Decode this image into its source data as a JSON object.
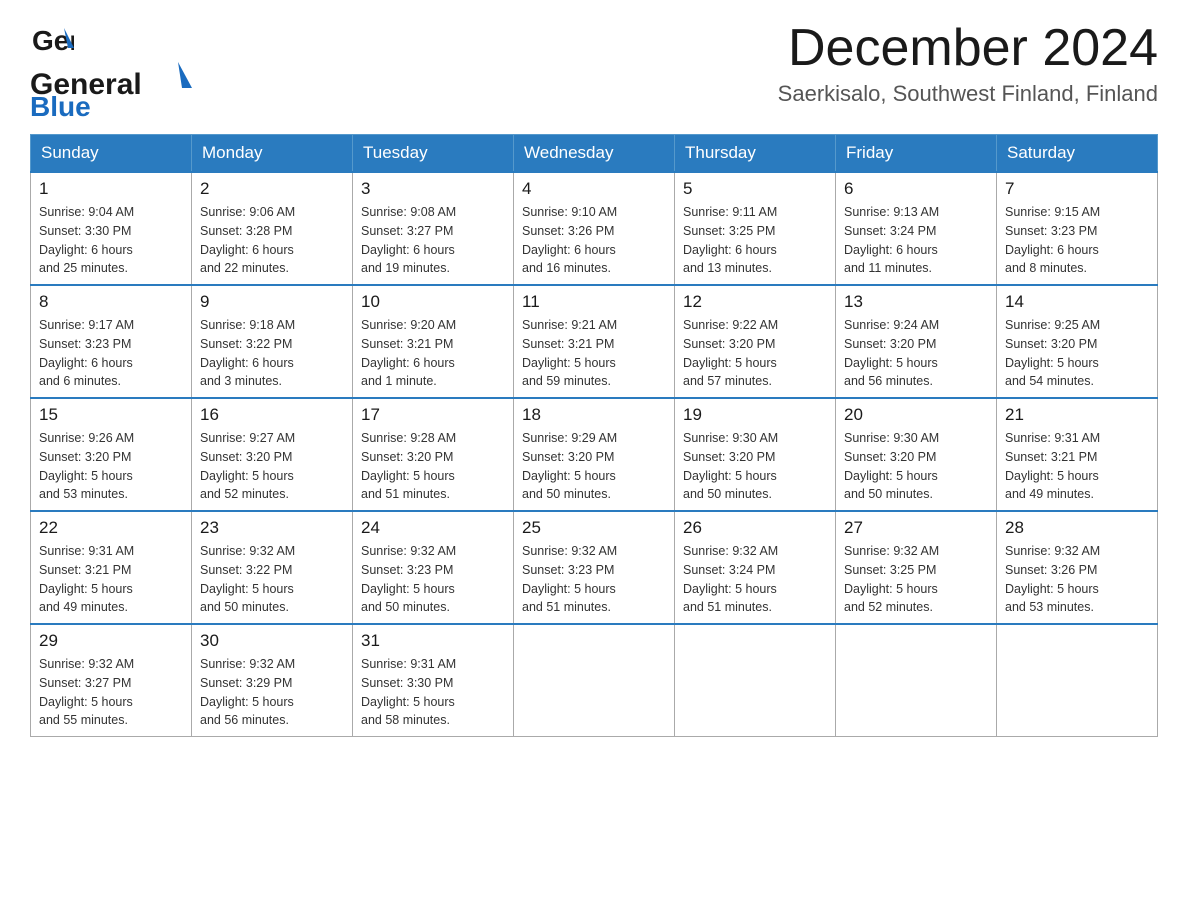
{
  "header": {
    "logo_general": "General",
    "logo_blue": "Blue",
    "month_title": "December 2024",
    "location": "Saerkisalo, Southwest Finland, Finland"
  },
  "weekdays": [
    "Sunday",
    "Monday",
    "Tuesday",
    "Wednesday",
    "Thursday",
    "Friday",
    "Saturday"
  ],
  "weeks": [
    [
      {
        "day": "1",
        "sunrise": "Sunrise: 9:04 AM",
        "sunset": "Sunset: 3:30 PM",
        "daylight": "Daylight: 6 hours",
        "daylight2": "and 25 minutes."
      },
      {
        "day": "2",
        "sunrise": "Sunrise: 9:06 AM",
        "sunset": "Sunset: 3:28 PM",
        "daylight": "Daylight: 6 hours",
        "daylight2": "and 22 minutes."
      },
      {
        "day": "3",
        "sunrise": "Sunrise: 9:08 AM",
        "sunset": "Sunset: 3:27 PM",
        "daylight": "Daylight: 6 hours",
        "daylight2": "and 19 minutes."
      },
      {
        "day": "4",
        "sunrise": "Sunrise: 9:10 AM",
        "sunset": "Sunset: 3:26 PM",
        "daylight": "Daylight: 6 hours",
        "daylight2": "and 16 minutes."
      },
      {
        "day": "5",
        "sunrise": "Sunrise: 9:11 AM",
        "sunset": "Sunset: 3:25 PM",
        "daylight": "Daylight: 6 hours",
        "daylight2": "and 13 minutes."
      },
      {
        "day": "6",
        "sunrise": "Sunrise: 9:13 AM",
        "sunset": "Sunset: 3:24 PM",
        "daylight": "Daylight: 6 hours",
        "daylight2": "and 11 minutes."
      },
      {
        "day": "7",
        "sunrise": "Sunrise: 9:15 AM",
        "sunset": "Sunset: 3:23 PM",
        "daylight": "Daylight: 6 hours",
        "daylight2": "and 8 minutes."
      }
    ],
    [
      {
        "day": "8",
        "sunrise": "Sunrise: 9:17 AM",
        "sunset": "Sunset: 3:23 PM",
        "daylight": "Daylight: 6 hours",
        "daylight2": "and 6 minutes."
      },
      {
        "day": "9",
        "sunrise": "Sunrise: 9:18 AM",
        "sunset": "Sunset: 3:22 PM",
        "daylight": "Daylight: 6 hours",
        "daylight2": "and 3 minutes."
      },
      {
        "day": "10",
        "sunrise": "Sunrise: 9:20 AM",
        "sunset": "Sunset: 3:21 PM",
        "daylight": "Daylight: 6 hours",
        "daylight2": "and 1 minute."
      },
      {
        "day": "11",
        "sunrise": "Sunrise: 9:21 AM",
        "sunset": "Sunset: 3:21 PM",
        "daylight": "Daylight: 5 hours",
        "daylight2": "and 59 minutes."
      },
      {
        "day": "12",
        "sunrise": "Sunrise: 9:22 AM",
        "sunset": "Sunset: 3:20 PM",
        "daylight": "Daylight: 5 hours",
        "daylight2": "and 57 minutes."
      },
      {
        "day": "13",
        "sunrise": "Sunrise: 9:24 AM",
        "sunset": "Sunset: 3:20 PM",
        "daylight": "Daylight: 5 hours",
        "daylight2": "and 56 minutes."
      },
      {
        "day": "14",
        "sunrise": "Sunrise: 9:25 AM",
        "sunset": "Sunset: 3:20 PM",
        "daylight": "Daylight: 5 hours",
        "daylight2": "and 54 minutes."
      }
    ],
    [
      {
        "day": "15",
        "sunrise": "Sunrise: 9:26 AM",
        "sunset": "Sunset: 3:20 PM",
        "daylight": "Daylight: 5 hours",
        "daylight2": "and 53 minutes."
      },
      {
        "day": "16",
        "sunrise": "Sunrise: 9:27 AM",
        "sunset": "Sunset: 3:20 PM",
        "daylight": "Daylight: 5 hours",
        "daylight2": "and 52 minutes."
      },
      {
        "day": "17",
        "sunrise": "Sunrise: 9:28 AM",
        "sunset": "Sunset: 3:20 PM",
        "daylight": "Daylight: 5 hours",
        "daylight2": "and 51 minutes."
      },
      {
        "day": "18",
        "sunrise": "Sunrise: 9:29 AM",
        "sunset": "Sunset: 3:20 PM",
        "daylight": "Daylight: 5 hours",
        "daylight2": "and 50 minutes."
      },
      {
        "day": "19",
        "sunrise": "Sunrise: 9:30 AM",
        "sunset": "Sunset: 3:20 PM",
        "daylight": "Daylight: 5 hours",
        "daylight2": "and 50 minutes."
      },
      {
        "day": "20",
        "sunrise": "Sunrise: 9:30 AM",
        "sunset": "Sunset: 3:20 PM",
        "daylight": "Daylight: 5 hours",
        "daylight2": "and 50 minutes."
      },
      {
        "day": "21",
        "sunrise": "Sunrise: 9:31 AM",
        "sunset": "Sunset: 3:21 PM",
        "daylight": "Daylight: 5 hours",
        "daylight2": "and 49 minutes."
      }
    ],
    [
      {
        "day": "22",
        "sunrise": "Sunrise: 9:31 AM",
        "sunset": "Sunset: 3:21 PM",
        "daylight": "Daylight: 5 hours",
        "daylight2": "and 49 minutes."
      },
      {
        "day": "23",
        "sunrise": "Sunrise: 9:32 AM",
        "sunset": "Sunset: 3:22 PM",
        "daylight": "Daylight: 5 hours",
        "daylight2": "and 50 minutes."
      },
      {
        "day": "24",
        "sunrise": "Sunrise: 9:32 AM",
        "sunset": "Sunset: 3:23 PM",
        "daylight": "Daylight: 5 hours",
        "daylight2": "and 50 minutes."
      },
      {
        "day": "25",
        "sunrise": "Sunrise: 9:32 AM",
        "sunset": "Sunset: 3:23 PM",
        "daylight": "Daylight: 5 hours",
        "daylight2": "and 51 minutes."
      },
      {
        "day": "26",
        "sunrise": "Sunrise: 9:32 AM",
        "sunset": "Sunset: 3:24 PM",
        "daylight": "Daylight: 5 hours",
        "daylight2": "and 51 minutes."
      },
      {
        "day": "27",
        "sunrise": "Sunrise: 9:32 AM",
        "sunset": "Sunset: 3:25 PM",
        "daylight": "Daylight: 5 hours",
        "daylight2": "and 52 minutes."
      },
      {
        "day": "28",
        "sunrise": "Sunrise: 9:32 AM",
        "sunset": "Sunset: 3:26 PM",
        "daylight": "Daylight: 5 hours",
        "daylight2": "and 53 minutes."
      }
    ],
    [
      {
        "day": "29",
        "sunrise": "Sunrise: 9:32 AM",
        "sunset": "Sunset: 3:27 PM",
        "daylight": "Daylight: 5 hours",
        "daylight2": "and 55 minutes."
      },
      {
        "day": "30",
        "sunrise": "Sunrise: 9:32 AM",
        "sunset": "Sunset: 3:29 PM",
        "daylight": "Daylight: 5 hours",
        "daylight2": "and 56 minutes."
      },
      {
        "day": "31",
        "sunrise": "Sunrise: 9:31 AM",
        "sunset": "Sunset: 3:30 PM",
        "daylight": "Daylight: 5 hours",
        "daylight2": "and 58 minutes."
      },
      {
        "day": "",
        "sunrise": "",
        "sunset": "",
        "daylight": "",
        "daylight2": ""
      },
      {
        "day": "",
        "sunrise": "",
        "sunset": "",
        "daylight": "",
        "daylight2": ""
      },
      {
        "day": "",
        "sunrise": "",
        "sunset": "",
        "daylight": "",
        "daylight2": ""
      },
      {
        "day": "",
        "sunrise": "",
        "sunset": "",
        "daylight": "",
        "daylight2": ""
      }
    ]
  ]
}
